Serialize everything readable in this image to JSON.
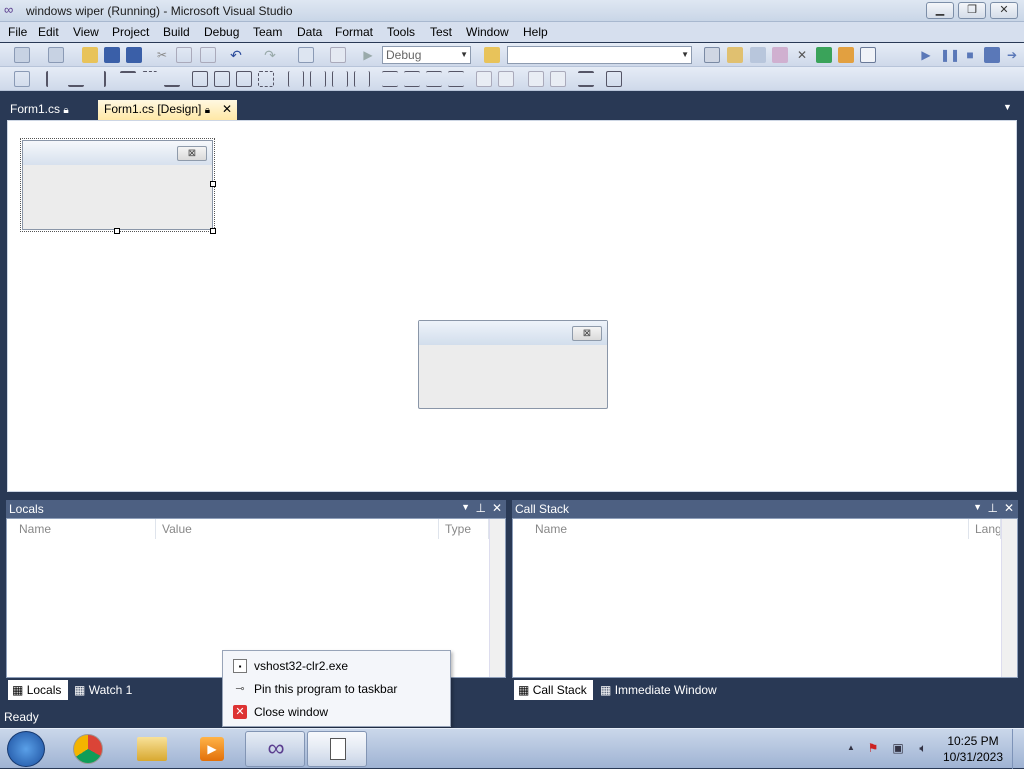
{
  "window": {
    "title": "windows wiper (Running) - Microsoft Visual Studio",
    "minimize": "▁",
    "restore": "❐",
    "close": "✕"
  },
  "menu": [
    "File",
    "Edit",
    "View",
    "Project",
    "Build",
    "Debug",
    "Team",
    "Data",
    "Format",
    "Tools",
    "Test",
    "Window",
    "Help"
  ],
  "toolbar": {
    "config_value": "Debug",
    "find_value": ""
  },
  "tabs": [
    {
      "label": "Form1.cs"
    },
    {
      "label": "Form1.cs [Design]"
    }
  ],
  "designer": {
    "form1_close": "⊠",
    "form2_close": "⊠"
  },
  "locals": {
    "title": "Locals",
    "columns": [
      "Name",
      "Value",
      "Type"
    ],
    "tabs": [
      "Locals",
      "Watch 1"
    ]
  },
  "callstack": {
    "title": "Call Stack",
    "columns": [
      "Name",
      "Lang"
    ],
    "tabs": [
      "Call Stack",
      "Immediate Window"
    ]
  },
  "context_menu": {
    "items": [
      "vshost32-clr2.exe",
      "Pin this program to taskbar",
      "Close window"
    ]
  },
  "status": "Ready",
  "taskbar": {
    "time": "10:25 PM",
    "date": "10/31/2023"
  },
  "colors": {
    "chrome": "#293955",
    "active_tab": "#ffe8a6",
    "panel_header": "#4d6082"
  }
}
